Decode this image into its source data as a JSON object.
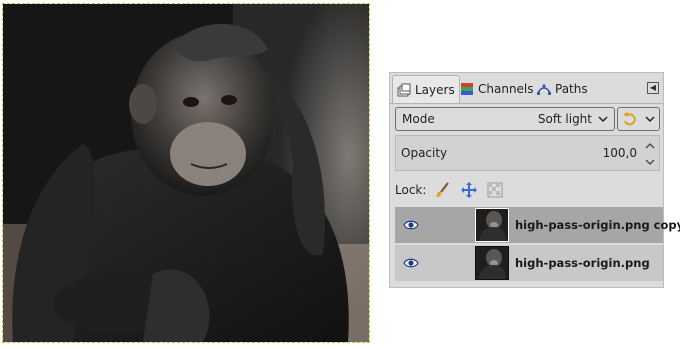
{
  "canvas": {
    "image_alt": "chimpanzee-photo"
  },
  "tabs": [
    {
      "label": "Layers",
      "icon": "layers-icon"
    },
    {
      "label": "Channels",
      "icon": "channels-icon"
    },
    {
      "label": "Paths",
      "icon": "paths-icon"
    }
  ],
  "mode": {
    "label": "Mode",
    "value": "Soft light"
  },
  "opacity": {
    "label": "Opacity",
    "value": "100,0"
  },
  "lock": {
    "label": "Lock:"
  },
  "layers": [
    {
      "name": "high-pass-origin.png copy",
      "visible": true,
      "selected": true
    },
    {
      "name": "high-pass-origin.png",
      "visible": true,
      "selected": false
    }
  ],
  "colors": {
    "panel_bg": "#dcdcdc",
    "selected_row": "#a6a6a6",
    "selection_outline": "#c9c43a"
  }
}
